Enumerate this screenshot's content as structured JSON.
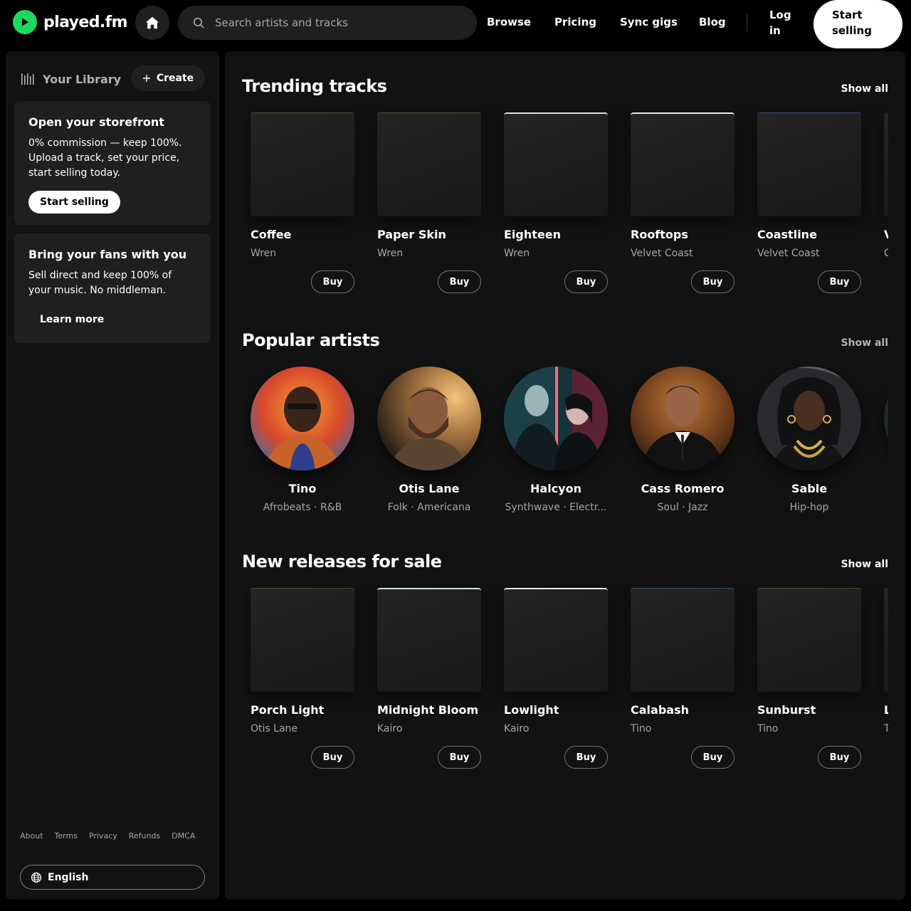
{
  "brand": {
    "name": "played.fm",
    "accent": "#1ed760"
  },
  "search": {
    "placeholder": "Search artists and tracks"
  },
  "nav": {
    "browse": "Browse",
    "pricing": "Pricing",
    "sync_gigs": "Sync gigs",
    "blog": "Blog",
    "login": "Log in",
    "start_selling": "Start selling"
  },
  "sidebar": {
    "library_label": "Your Library",
    "create_label": "Create",
    "promo_storefront": {
      "title": "Open your storefront",
      "body": "0% commission — keep 100%. Upload a track, set your price, start selling today.",
      "button": "Start selling"
    },
    "promo_fans": {
      "title": "Bring your fans with you",
      "body": "Sell direct and keep 100% of your music. No middleman.",
      "button": "Learn more"
    },
    "footer_links": [
      "About",
      "Terms",
      "Privacy",
      "Refunds",
      "DMCA"
    ],
    "language": "English"
  },
  "trending": {
    "title": "Trending tracks",
    "show_all": "Show all",
    "buy_label": "Buy",
    "items": [
      {
        "title": "Coffee",
        "artist": "Wren"
      },
      {
        "title": "Paper Skin",
        "artist": "Wren"
      },
      {
        "title": "Eighteen",
        "artist": "Wren"
      },
      {
        "title": "Rooftops",
        "artist": "Velvet Coast"
      },
      {
        "title": "Coastline",
        "artist": "Velvet Coast"
      },
      {
        "title": "V",
        "artist": "C"
      }
    ]
  },
  "artists": {
    "title": "Popular artists",
    "show_all": "Show all",
    "items": [
      {
        "name": "Tino",
        "genre": "Afrobeats · R&B"
      },
      {
        "name": "Otis Lane",
        "genre": "Folk · Americana"
      },
      {
        "name": "Halcyon",
        "genre": "Synthwave · Electr..."
      },
      {
        "name": "Cass Romero",
        "genre": "Soul · Jazz"
      },
      {
        "name": "Sable",
        "genre": "Hip-hop"
      }
    ]
  },
  "releases": {
    "title": "New releases for sale",
    "show_all": "Show all",
    "buy_label": "Buy",
    "items": [
      {
        "title": "Porch Light",
        "artist": "Otis Lane"
      },
      {
        "title": "Midnight Bloom",
        "artist": "Kairo"
      },
      {
        "title": "Lowlight",
        "artist": "Kairo"
      },
      {
        "title": "Calabash",
        "artist": "Tino"
      },
      {
        "title": "Sunburst",
        "artist": "Tino"
      },
      {
        "title": "L",
        "artist": "T"
      }
    ]
  }
}
